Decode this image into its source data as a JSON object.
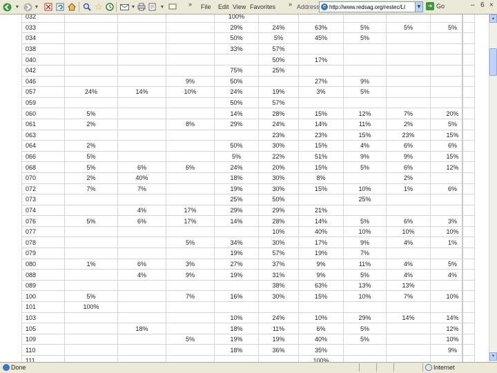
{
  "toolbar": {
    "icons": [
      "back-icon",
      "forward-icon",
      "stop-icon",
      "refresh-icon",
      "home-icon",
      "search-icon",
      "favorites-icon",
      "history-icon",
      "mail-icon",
      "print-icon",
      "edit-icon",
      "discuss-icon"
    ],
    "menus": [
      "File",
      "Edit",
      "View",
      "Favorites"
    ],
    "chevron": "»",
    "address_label": "Address",
    "address_value": "http://www.redsag.org/restec/LCP",
    "go_label": "Go",
    "win_min": "–",
    "win_max": "6",
    "win_close": "×"
  },
  "table": {
    "rows": [
      [
        "032",
        "",
        "",
        "",
        "100%",
        "",
        "",
        "",
        "",
        ""
      ],
      [
        "033",
        "",
        "",
        "",
        "29%",
        "24%",
        "63%",
        "5%",
        "5%",
        "5%"
      ],
      [
        "034",
        "",
        "",
        "",
        "50%",
        "5%",
        "45%",
        "5%",
        "",
        ""
      ],
      [
        "038",
        "",
        "",
        "",
        "33%",
        "57%",
        "",
        "",
        "",
        ""
      ],
      [
        "040",
        "",
        "",
        "",
        "",
        "50%",
        "17%",
        "",
        "",
        ""
      ],
      [
        "042",
        "",
        "",
        "",
        "75%",
        "25%",
        "",
        "",
        "",
        ""
      ],
      [
        "046",
        "",
        "",
        "9%",
        "50%",
        "",
        "27%",
        "9%",
        "",
        ""
      ],
      [
        "057",
        "24%",
        "14%",
        "10%",
        "24%",
        "19%",
        "3%",
        "5%",
        "",
        ""
      ],
      [
        "059",
        "",
        "",
        "",
        "50%",
        "57%",
        "",
        "",
        "",
        ""
      ],
      [
        "060",
        "5%",
        "",
        "",
        "14%",
        "28%",
        "15%",
        "12%",
        "7%",
        "20%"
      ],
      [
        "061",
        "2%",
        "",
        "8%",
        "29%",
        "24%",
        "14%",
        "11%",
        "2%",
        "5%"
      ],
      [
        "063",
        "",
        "",
        "",
        "",
        "23%",
        "23%",
        "15%",
        "23%",
        "15%"
      ],
      [
        "064",
        "2%",
        "",
        "",
        "50%",
        "30%",
        "15%",
        "4%",
        "6%",
        "6%"
      ],
      [
        "066",
        "5%",
        "",
        "",
        "5%",
        "22%",
        "51%",
        "9%",
        "9%",
        "15%"
      ],
      [
        "068",
        "5%",
        "6%",
        "6%",
        "24%",
        "20%",
        "15%",
        "5%",
        "6%",
        "12%"
      ],
      [
        "070",
        "2%",
        "40%",
        "",
        "18%",
        "30%",
        "8%",
        "",
        "2%",
        ""
      ],
      [
        "072",
        "7%",
        "7%",
        "",
        "19%",
        "30%",
        "15%",
        "10%",
        "1%",
        "6%"
      ],
      [
        "073",
        "",
        "",
        "",
        "25%",
        "50%",
        "",
        "25%",
        "",
        ""
      ],
      [
        "074",
        "",
        "4%",
        "17%",
        "29%",
        "29%",
        "21%",
        "",
        "",
        ""
      ],
      [
        "076",
        "5%",
        "6%",
        "17%",
        "14%",
        "28%",
        "14%",
        "5%",
        "6%",
        "3%"
      ],
      [
        "077",
        "",
        "",
        "",
        "",
        "10%",
        "40%",
        "10%",
        "10%",
        "10%"
      ],
      [
        "078",
        "",
        "",
        "5%",
        "34%",
        "30%",
        "17%",
        "9%",
        "4%",
        "1%"
      ],
      [
        "079",
        "",
        "",
        "",
        "19%",
        "57%",
        "19%",
        "7%",
        "",
        ""
      ],
      [
        "080",
        "1%",
        "6%",
        "3%",
        "27%",
        "37%",
        "9%",
        "11%",
        "4%",
        "5%"
      ],
      [
        "088",
        "",
        "4%",
        "9%",
        "19%",
        "31%",
        "9%",
        "5%",
        "4%",
        "4%"
      ],
      [
        "089",
        "",
        "",
        "",
        "",
        "38%",
        "63%",
        "13%",
        "13%",
        ""
      ],
      [
        "100",
        "5%",
        "",
        "7%",
        "16%",
        "30%",
        "15%",
        "10%",
        "7%",
        "10%"
      ],
      [
        "101",
        "100%",
        "",
        "",
        "",
        "",
        "",
        "",
        "",
        ""
      ],
      [
        "103",
        "",
        "",
        "",
        "10%",
        "24%",
        "10%",
        "29%",
        "14%",
        "14%"
      ],
      [
        "105",
        "",
        "18%",
        "",
        "18%",
        "11%",
        "6%",
        "5%",
        "",
        "12%"
      ],
      [
        "109",
        "",
        "",
        "5%",
        "19%",
        "19%",
        "40%",
        "5%",
        "",
        "10%"
      ],
      [
        "110",
        "",
        "",
        "",
        "18%",
        "36%",
        "35%",
        "",
        "",
        "9%"
      ],
      [
        "111",
        "",
        "",
        "",
        "",
        "",
        "100%",
        "",
        "",
        ""
      ]
    ]
  },
  "statusbar": {
    "text": "Done",
    "zone": "Internet"
  }
}
